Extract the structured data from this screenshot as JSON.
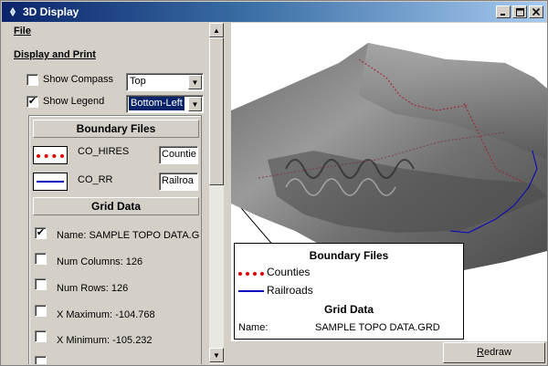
{
  "window": {
    "title": "3D Display"
  },
  "menu": {
    "file": "File"
  },
  "display_print": {
    "title": "Display and Print",
    "show_compass": {
      "label": "Show Compass",
      "checked": false,
      "value": "Top"
    },
    "show_legend": {
      "label": "Show Legend",
      "checked": true,
      "value": "Bottom-Left"
    }
  },
  "boundary": {
    "title": "Boundary Files",
    "items": [
      {
        "name": "CO_HIRES",
        "text": "Countie",
        "color": "#e00000",
        "style": "dotted"
      },
      {
        "name": "CO_RR",
        "text": "Railroa",
        "color": "#0000c0",
        "style": "solid"
      }
    ]
  },
  "grid": {
    "title": "Grid Data",
    "items": [
      {
        "label": "Name: SAMPLE TOPO DATA.G",
        "checked": true
      },
      {
        "label": "Num Columns: 126",
        "checked": false
      },
      {
        "label": "Num Rows: 126",
        "checked": false
      },
      {
        "label": "X Maximum: -104.768",
        "checked": false
      },
      {
        "label": "X Minimum: -105.232",
        "checked": false
      }
    ]
  },
  "legend": {
    "boundary_title": "Boundary Files",
    "counties": "Counties",
    "railroads": "Railroads",
    "grid_title": "Grid Data",
    "name_label": "Name:",
    "name_value": "SAMPLE TOPO DATA.GRD"
  },
  "redraw": {
    "label": "Redraw",
    "underline": "R",
    "rest": "edraw"
  },
  "colors": {
    "titlebar": "#0a246a",
    "counties": "#e00000",
    "railroads": "#0000c0"
  }
}
